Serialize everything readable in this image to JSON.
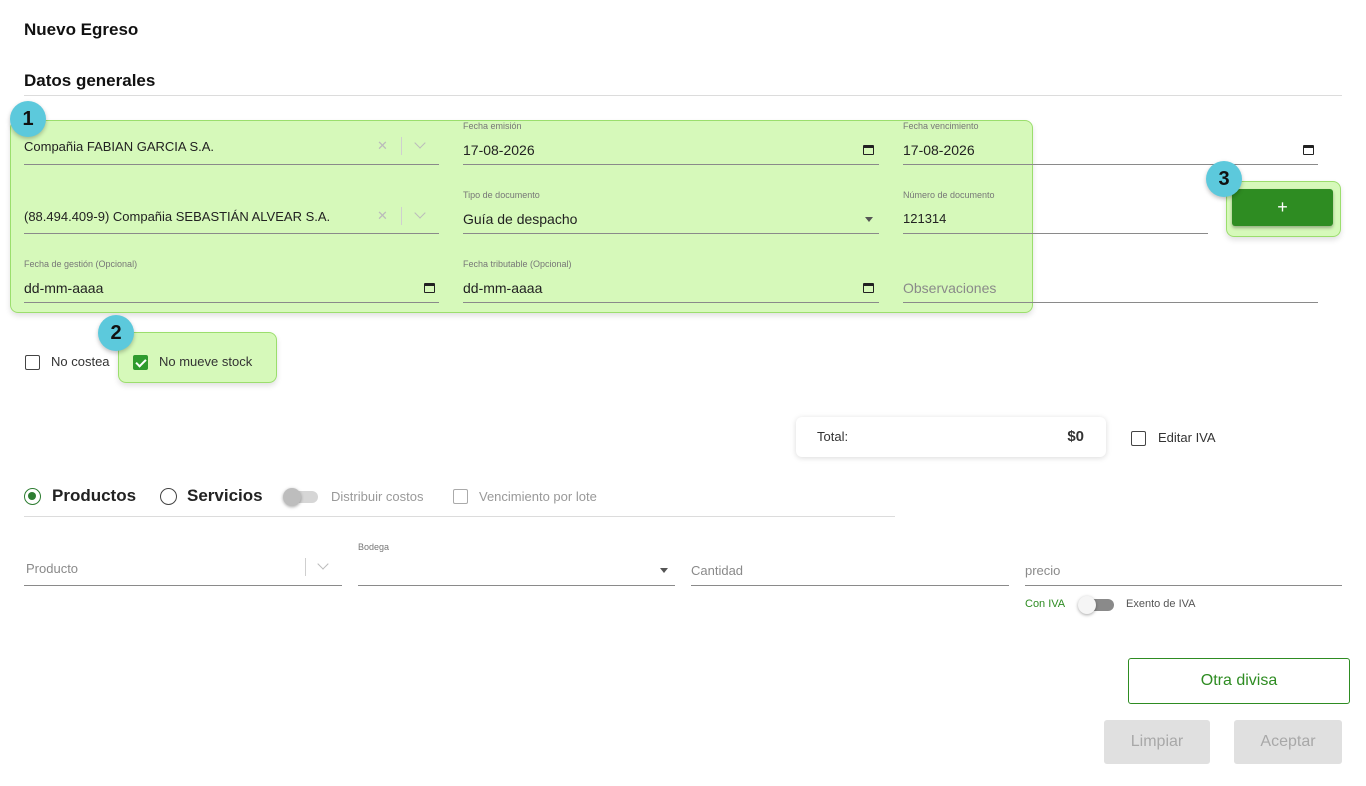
{
  "page": {
    "title": "Nuevo Egreso",
    "section_title": "Datos generales"
  },
  "form": {
    "company": {
      "value": "Compañia FABIAN GARCIA S.A."
    },
    "fecha_emision": {
      "label": "Fecha emisión",
      "value": "17-08-2026"
    },
    "fecha_vencimiento": {
      "label": "Fecha vencimiento",
      "value": "17-08-2026"
    },
    "supplier": {
      "value": "(88.494.409-9) Compañia SEBASTIÁN ALVEAR S.A."
    },
    "tipo_documento": {
      "label": "Tipo de documento",
      "value": "Guía de despacho"
    },
    "numero_documento": {
      "label": "Número de documento",
      "value": "121314"
    },
    "fecha_gestion": {
      "label": "Fecha de gestión (Opcional)",
      "value": "dd-mm-aaaa"
    },
    "fecha_tributable": {
      "label": "Fecha tributable (Opcional)",
      "value": "dd-mm-aaaa"
    },
    "observaciones": {
      "placeholder": "Observaciones"
    },
    "add_button_label": "+"
  },
  "options": {
    "no_costea": {
      "label": "No costea",
      "checked": false
    },
    "no_mueve_stock": {
      "label": "No mueve stock",
      "checked": true
    }
  },
  "totals": {
    "label": "Total:",
    "value": "$0",
    "editar_iva": {
      "label": "Editar IVA",
      "checked": false
    }
  },
  "items": {
    "radio_productos": "Productos",
    "radio_servicios": "Servicios",
    "selected": "Productos",
    "distribuir_costos": {
      "label": "Distribuir costos",
      "on": false
    },
    "vencimiento_por_lote": {
      "label": "Vencimiento por lote",
      "checked": false
    },
    "producto": {
      "placeholder": "Producto"
    },
    "bodega": {
      "label": "Bodega",
      "value": ""
    },
    "cantidad": {
      "placeholder": "Cantidad"
    },
    "precio": {
      "placeholder": "precio"
    },
    "iva_toggle": {
      "left_label": "Con IVA",
      "right_label": "Exento de IVA"
    }
  },
  "actions": {
    "otra_divisa": "Otra divisa",
    "limpiar": "Limpiar",
    "aceptar": "Aceptar"
  },
  "annotations": {
    "badge_1": "1",
    "badge_2": "2",
    "badge_3": "3"
  },
  "colors": {
    "primary_green": "#2e8c22",
    "highlight": "#a3f266",
    "badge": "#5cc9dc"
  }
}
